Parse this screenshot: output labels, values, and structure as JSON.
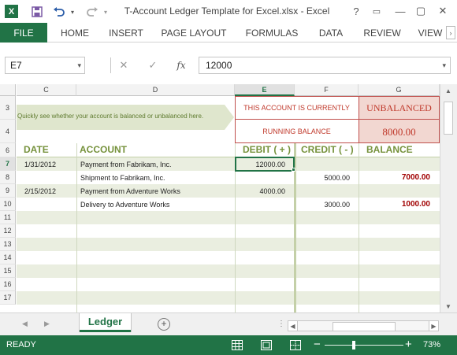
{
  "app": {
    "logo_letter": "X",
    "title": "T-Account Ledger Template for Excel.xlsx - Excel",
    "window_controls": [
      "?",
      "▭",
      "—",
      "▢",
      "✕"
    ]
  },
  "ribbon": {
    "tabs": [
      "FILE",
      "HOME",
      "INSERT",
      "PAGE LAYOUT",
      "FORMULAS",
      "DATA",
      "REVIEW",
      "VIEW"
    ]
  },
  "formula_bar": {
    "name_box": "E7",
    "cancel_glyph": "✕",
    "enter_glyph": "✓",
    "fx_label": "fx",
    "formula_value": "12000"
  },
  "columns": [
    "C",
    "D",
    "E",
    "F",
    "G"
  ],
  "selected_column": "E",
  "rows": [
    "3",
    "4",
    "6",
    "7",
    "8",
    "9",
    "10",
    "11",
    "12",
    "13",
    "14",
    "15",
    "16",
    "17"
  ],
  "selected_row": "7",
  "banner": {
    "hint": "Quickly see whether your account is balanced or unbalanced here.",
    "status_label": "THIS ACCOUNT IS CURRENTLY",
    "status_value": "UNBALANCED",
    "balance_label": "RUNNING BALANCE",
    "balance_value": "8000.00"
  },
  "ledger": {
    "headers": {
      "date": "DATE",
      "account": "ACCOUNT",
      "debit": "DEBIT ( + )",
      "credit": "CREDIT ( - )",
      "balance": "BALANCE"
    },
    "entries": [
      {
        "date": "1/31/2012",
        "account": "Payment from Fabrikam, Inc.",
        "debit": "12000.00",
        "credit": "",
        "balance": ""
      },
      {
        "date": "",
        "account": "Shipment to Fabrikam, Inc.",
        "debit": "",
        "credit": "5000.00",
        "balance": "7000.00"
      },
      {
        "date": "2/15/2012",
        "account": "Payment from Adventure Works",
        "debit": "4000.00",
        "credit": "",
        "balance": ""
      },
      {
        "date": "",
        "account": "Delivery to Adventure Works",
        "debit": "",
        "credit": "3000.00",
        "balance": "1000.00"
      }
    ]
  },
  "sheets": {
    "active": "Ledger",
    "add_label": "+",
    "more_label": "⋮"
  },
  "status": {
    "ready": "READY",
    "zoom_minus": "−",
    "zoom_plus": "+",
    "zoom": "73%",
    "zoom_fraction": 0.365
  },
  "colors": {
    "excel_green": "#217346",
    "header_olive": "#76923c",
    "band_green": "#eaeee0",
    "banner_green": "#dfe6cd",
    "unbalanced_bg": "#f2d7d1",
    "unbalanced_text": "#c0392b",
    "balance_red": "#a00000"
  }
}
